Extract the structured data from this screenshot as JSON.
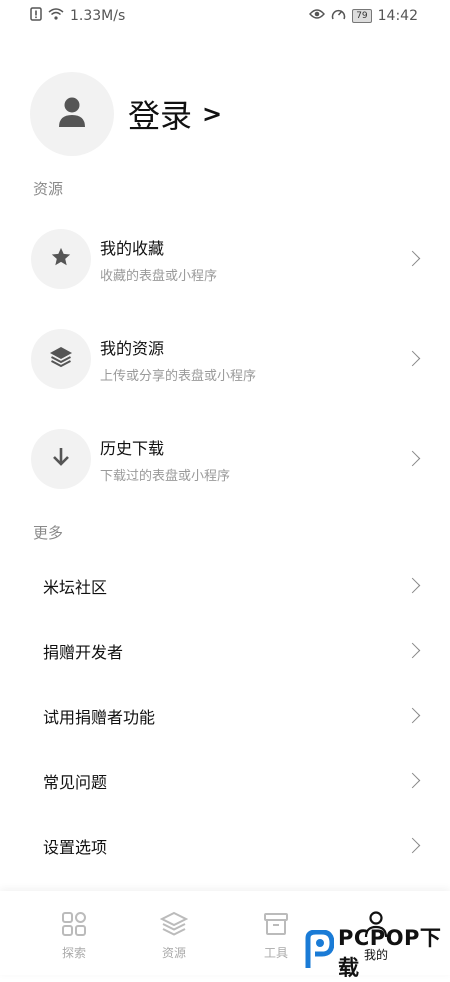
{
  "status": {
    "speed": "1.33M/s",
    "battery": "79",
    "time": "14:42"
  },
  "profile": {
    "login_label": "登录",
    "arrow": ">"
  },
  "section_resources": "资源",
  "resource_items": [
    {
      "title": "我的收藏",
      "subtitle": "收藏的表盘或小程序",
      "icon": "star-icon"
    },
    {
      "title": "我的资源",
      "subtitle": "上传或分享的表盘或小程序",
      "icon": "layers-icon"
    },
    {
      "title": "历史下载",
      "subtitle": "下载过的表盘或小程序",
      "icon": "download-icon"
    }
  ],
  "section_more": "更多",
  "more_items": [
    {
      "label": "米坛社区"
    },
    {
      "label": "捐赠开发者"
    },
    {
      "label": "试用捐赠者功能"
    },
    {
      "label": "常见问题"
    },
    {
      "label": "设置选项"
    }
  ],
  "tabs": [
    {
      "label": "探索",
      "icon": "grid-icon"
    },
    {
      "label": "资源",
      "icon": "layers-icon"
    },
    {
      "label": "工具",
      "icon": "toolbox-icon"
    },
    {
      "label": "我的",
      "icon": "person-icon"
    }
  ],
  "watermark": {
    "text": "PCPOP下载"
  }
}
